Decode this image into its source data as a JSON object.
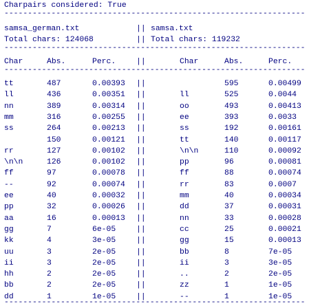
{
  "console": {
    "title_line": "Charpairs considered: True",
    "rule": "------------------------------------------------------------------",
    "left_file": "samsa_german.txt",
    "right_file": "samsa.txt",
    "left_total": "Total chars: 124068",
    "right_total": "Total chars: 119232",
    "separator": "||",
    "headers": {
      "char": "Char",
      "abs": "Abs.",
      "perc": "Perc."
    },
    "rows": [
      {
        "l_char": "tt",
        "l_abs": "487",
        "l_perc": "0.00393",
        "r_char": "",
        "r_abs": "595",
        "r_perc": "0.00499"
      },
      {
        "l_char": "ll",
        "l_abs": "436",
        "l_perc": "0.00351",
        "r_char": "ll",
        "r_abs": "525",
        "r_perc": "0.0044"
      },
      {
        "l_char": "nn",
        "l_abs": "389",
        "l_perc": "0.00314",
        "r_char": "oo",
        "r_abs": "493",
        "r_perc": "0.00413"
      },
      {
        "l_char": "mm",
        "l_abs": "316",
        "l_perc": "0.00255",
        "r_char": "ee",
        "r_abs": "393",
        "r_perc": "0.0033"
      },
      {
        "l_char": "ss",
        "l_abs": "264",
        "l_perc": "0.00213",
        "r_char": "ss",
        "r_abs": "192",
        "r_perc": "0.00161"
      },
      {
        "l_char": "",
        "l_abs": "150",
        "l_perc": "0.00121",
        "r_char": "tt",
        "r_abs": "140",
        "r_perc": "0.00117"
      },
      {
        "l_char": "rr",
        "l_abs": "127",
        "l_perc": "0.00102",
        "r_char": "\\n\\n",
        "r_abs": "110",
        "r_perc": "0.00092"
      },
      {
        "l_char": "\\n\\n",
        "l_abs": "126",
        "l_perc": "0.00102",
        "r_char": "pp",
        "r_abs": "96",
        "r_perc": "0.00081"
      },
      {
        "l_char": "ff",
        "l_abs": "97",
        "l_perc": "0.00078",
        "r_char": "ff",
        "r_abs": "88",
        "r_perc": "0.00074"
      },
      {
        "l_char": "--",
        "l_abs": "92",
        "l_perc": "0.00074",
        "r_char": "rr",
        "r_abs": "83",
        "r_perc": "0.0007"
      },
      {
        "l_char": "ee",
        "l_abs": "40",
        "l_perc": "0.00032",
        "r_char": "mm",
        "r_abs": "40",
        "r_perc": "0.00034"
      },
      {
        "l_char": "pp",
        "l_abs": "32",
        "l_perc": "0.00026",
        "r_char": "dd",
        "r_abs": "37",
        "r_perc": "0.00031"
      },
      {
        "l_char": "aa",
        "l_abs": "16",
        "l_perc": "0.00013",
        "r_char": "nn",
        "r_abs": "33",
        "r_perc": "0.00028"
      },
      {
        "l_char": "gg",
        "l_abs": "7",
        "l_perc": "6e-05",
        "r_char": "cc",
        "r_abs": "25",
        "r_perc": "0.00021"
      },
      {
        "l_char": "kk",
        "l_abs": "4",
        "l_perc": "3e-05",
        "r_char": "gg",
        "r_abs": "15",
        "r_perc": "0.00013"
      },
      {
        "l_char": "uu",
        "l_abs": "3",
        "l_perc": "2e-05",
        "r_char": "bb",
        "r_abs": "8",
        "r_perc": "7e-05"
      },
      {
        "l_char": "ii",
        "l_abs": "3",
        "l_perc": "2e-05",
        "r_char": "ii",
        "r_abs": "3",
        "r_perc": "3e-05"
      },
      {
        "l_char": "hh",
        "l_abs": "2",
        "l_perc": "2e-05",
        "r_char": "..",
        "r_abs": "2",
        "r_perc": "2e-05"
      },
      {
        "l_char": "bb",
        "l_abs": "2",
        "l_perc": "2e-05",
        "r_char": "zz",
        "r_abs": "1",
        "r_perc": "1e-05"
      },
      {
        "l_char": "dd",
        "l_abs": "1",
        "l_perc": "1e-05",
        "r_char": "--",
        "r_abs": "1",
        "r_perc": "1e-05"
      }
    ],
    "colors": {
      "text": "#000080",
      "background": "#ffffff"
    }
  }
}
